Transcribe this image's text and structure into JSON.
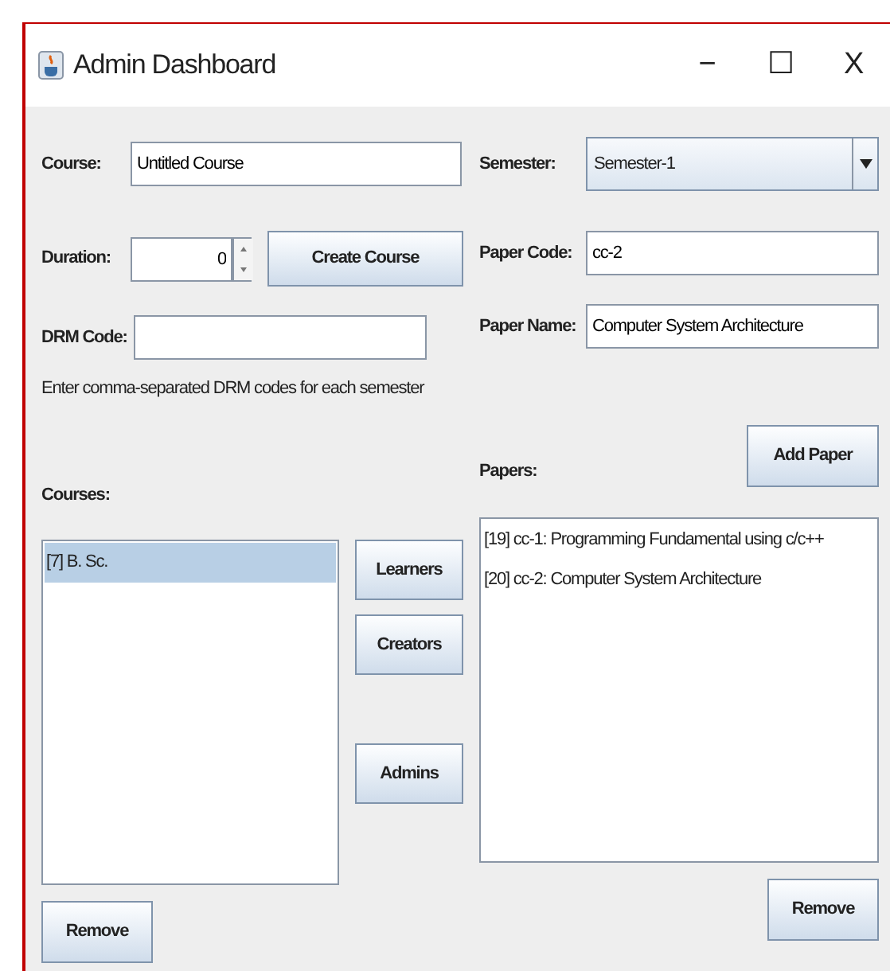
{
  "window": {
    "title": "Admin Dashboard",
    "controls": [
      "−",
      "☐",
      "X"
    ]
  },
  "course": {
    "label": "Course:",
    "value": "Untitled Course"
  },
  "semester": {
    "label": "Semester:",
    "value": "Semester-1"
  },
  "duration": {
    "label": "Duration:",
    "value": "0"
  },
  "create_button": "Create Course",
  "paper_code": {
    "label": "Paper Code:",
    "value": "cc-2"
  },
  "drm_code": {
    "label": "DRM Code:"
  },
  "paper_name": {
    "label": "Paper Name:",
    "value": "Computer System Architecture"
  },
  "hint": "Enter comma-separated DRM codes for each semester",
  "courses": {
    "label": "Courses:",
    "items": [
      {
        "text": "[7] B. Sc.",
        "selected": true
      }
    ],
    "remove": "Remove"
  },
  "papers": {
    "label": "Papers:",
    "add": "Add Paper",
    "items": [
      {
        "text": "[19] cc-1: Programming Fundamental using c/c++",
        "selected": false
      },
      {
        "text": "[20] cc-2: Computer System Architecture",
        "selected": false
      }
    ],
    "remove": "Remove"
  },
  "role_buttons": [
    "Learners",
    "Creators",
    "Admins"
  ]
}
